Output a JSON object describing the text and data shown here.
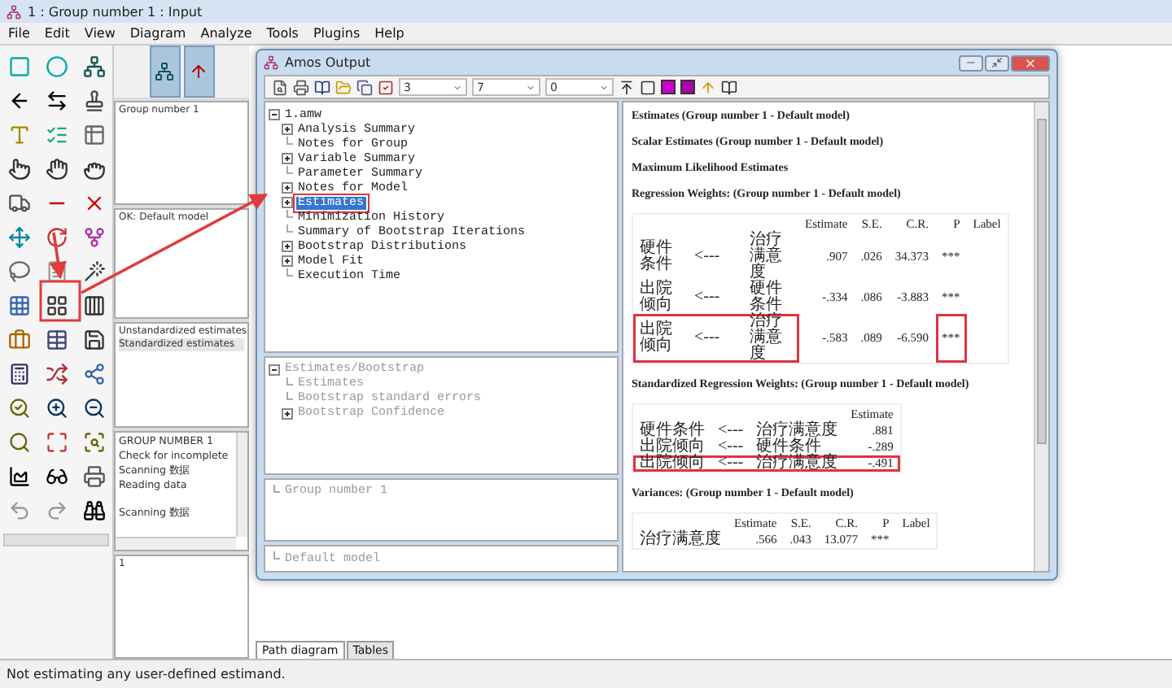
{
  "main_window": {
    "title": "1 : Group number 1 : Input"
  },
  "menu": [
    "File",
    "Edit",
    "View",
    "Diagram",
    "Analyze",
    "Tools",
    "Plugins",
    "Help"
  ],
  "panels": {
    "groups": [
      "Group number 1"
    ],
    "models": [
      "OK: Default model"
    ],
    "estimates": [
      {
        "label": "Unstandardized estimates",
        "selected": false
      },
      {
        "label": "Standardized estimates",
        "selected": true
      }
    ],
    "log": [
      [
        "GROUP NUMBER 1",
        "Check for incomplete",
        "Scanning 数据",
        "Reading data"
      ],
      [
        "Scanning 数据"
      ]
    ],
    "files": [
      "1"
    ]
  },
  "tabs": [
    {
      "label": "Path diagram",
      "selected": true
    },
    {
      "label": "Tables",
      "selected": false
    }
  ],
  "status_bar": "Not estimating any user-defined estimand.",
  "output_window": {
    "title": "Amos Output",
    "toolbar_fields": [
      "3",
      "7",
      "0"
    ],
    "trees": [
      {
        "disabled": false,
        "items": [
          {
            "label": "1.amw",
            "expanded": true,
            "selected": false,
            "highlighted": false,
            "children": [
              {
                "label": "Analysis Summary",
                "expanded": false,
                "selected": false,
                "highlighted": false
              },
              {
                "label": "Notes for Group",
                "selected": false,
                "highlighted": false
              },
              {
                "label": "Variable Summary",
                "expanded": false,
                "selected": false,
                "highlighted": false
              },
              {
                "label": "Parameter Summary",
                "selected": false,
                "highlighted": false
              },
              {
                "label": "Notes for Model",
                "expanded": false,
                "selected": false,
                "highlighted": false
              },
              {
                "label": "Estimates",
                "expanded": false,
                "selected": true,
                "highlighted": true
              },
              {
                "label": "Minimization History",
                "selected": false,
                "highlighted": false
              },
              {
                "label": "Summary of Bootstrap Iterations",
                "selected": false,
                "highlighted": false
              },
              {
                "label": "Bootstrap Distributions",
                "expanded": false,
                "selected": false,
                "highlighted": false
              },
              {
                "label": "Model Fit",
                "expanded": false,
                "selected": false,
                "highlighted": false
              },
              {
                "label": "Execution Time",
                "selected": false,
                "highlighted": false
              }
            ]
          }
        ]
      },
      {
        "disabled": true,
        "items": [
          {
            "label": "Estimates/Bootstrap",
            "expanded": true,
            "selected": false,
            "children": [
              {
                "label": "Estimates",
                "selected": false
              },
              {
                "label": "Bootstrap standard errors",
                "selected": false
              },
              {
                "label": "Bootstrap Confidence",
                "expanded": false,
                "selected": false
              }
            ]
          }
        ]
      },
      {
        "disabled": true,
        "items": [
          {
            "label": "Group number 1",
            "selected": false
          }
        ]
      },
      {
        "disabled": true,
        "items": [
          {
            "label": "Default model",
            "selected": false
          }
        ]
      }
    ],
    "content": [
      {
        "kind": "heading",
        "text": "Estimates (Group number 1 - Default model)"
      },
      {
        "kind": "heading",
        "text": "Scalar Estimates (Group number 1 - Default model)"
      },
      {
        "kind": "heading",
        "text": "Maximum Likelihood Estimates"
      },
      {
        "kind": "heading",
        "text": "Regression Weights: (Group number 1 - Default model)"
      },
      {
        "kind": "wrapped_table",
        "columns": [
          "",
          "",
          "",
          "Estimate",
          "S.E.",
          "C.R.",
          "P",
          "Label"
        ],
        "rows": [
          {
            "cells": [
              "硬件条件",
              "<---",
              "治疗满意度",
              ".907",
              ".026",
              "34.373",
              "***"
            ],
            "highlighted": false,
            "p_highlighted": false
          },
          {
            "cells": [
              "出院倾向",
              "<---",
              "硬件条件",
              "-.334",
              ".086",
              "-3.883",
              "***"
            ],
            "highlighted": false,
            "p_highlighted": false
          },
          {
            "cells": [
              "出院倾向",
              "<---",
              "治疗满意度",
              "-.583",
              ".089",
              "-6.590",
              "***"
            ],
            "highlighted": true,
            "p_highlighted": true
          }
        ]
      },
      {
        "kind": "heading",
        "text": "Standardized Regression Weights: (Group number 1 - Default model)"
      },
      {
        "kind": "table",
        "columns": [
          "",
          "",
          "",
          "Estimate"
        ],
        "rows": [
          {
            "cells": [
              "硬件条件",
              "<---",
              "治疗满意度",
              ".881"
            ],
            "highlighted": false
          },
          {
            "cells": [
              "出院倾向",
              "<---",
              "硬件条件",
              "-.289"
            ],
            "highlighted": false
          },
          {
            "cells": [
              "出院倾向",
              "<---",
              "治疗满意度",
              "-.491"
            ],
            "highlighted": true
          }
        ]
      },
      {
        "kind": "heading",
        "text": "Variances: (Group number 1 - Default model)"
      },
      {
        "kind": "table",
        "columns": [
          "",
          "Estimate",
          "S.E.",
          "C.R.",
          "P",
          "Label"
        ],
        "rows": [
          {
            "cells": [
              "治疗满意度",
              ".566",
              ".043",
              "13.077",
              "***"
            ],
            "highlighted": false
          }
        ]
      }
    ]
  }
}
